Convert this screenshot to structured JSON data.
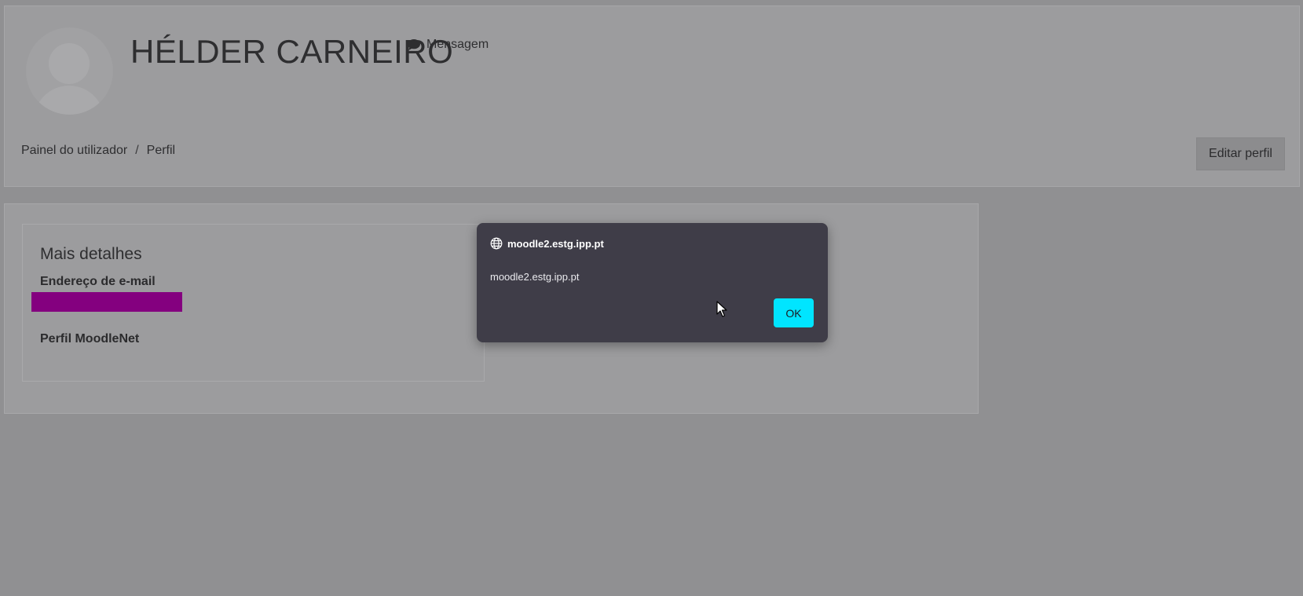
{
  "profile": {
    "name": "HÉLDER CARNEIRO",
    "message_label": "Mensagem"
  },
  "breadcrumb": {
    "items": [
      "Painel do utilizador",
      "Perfil"
    ],
    "separator": "/"
  },
  "header": {
    "edit_profile_label": "Editar perfil"
  },
  "details": {
    "title": "Mais detalhes",
    "email_label": "Endereço de e-mail",
    "moodlenet_label": "Perfil MoodleNet"
  },
  "alert": {
    "origin": "moodle2.estg.ipp.pt",
    "message": "moodle2.estg.ipp.pt",
    "ok_label": "OK"
  },
  "icons": {
    "message": "speech-bubble-icon",
    "alert_origin": "globe-icon",
    "avatar": "user-avatar-placeholder",
    "pointer": "mouse-cursor-icon"
  },
  "colors": {
    "page_overlay": "#909092",
    "card_background": "#9c9c9e",
    "dialog_background": "#3f3d48",
    "ok_button": "#00e5ff",
    "email_redaction": "#84007f",
    "edit_button": "#8c8c8e"
  }
}
